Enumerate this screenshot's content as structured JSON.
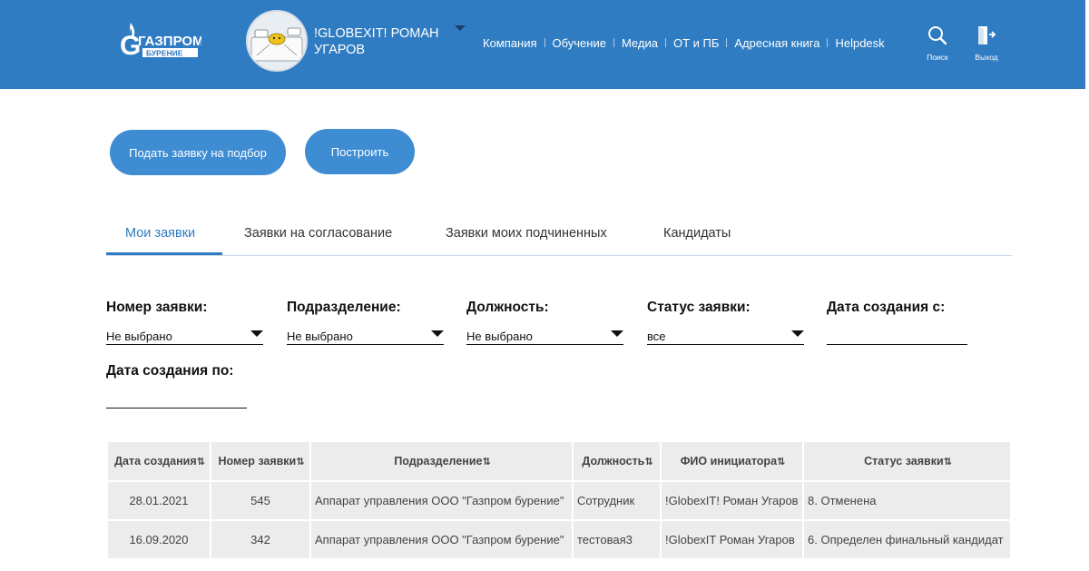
{
  "header": {
    "logo_line1": "ГАЗПРОМ",
    "logo_line2": "БУРЕНИЕ",
    "user_name": "!GLOBEXIT! РОМАН УГАРОВ",
    "nav": [
      "Компания",
      "Обучение",
      "Медиа",
      "ОТ и ПБ",
      "Адресная книга",
      "Helpdesk"
    ],
    "search_label": "Поиск",
    "exit_label": "Выход",
    "brand_color": "#2f7cc2"
  },
  "actions": {
    "request_button": "Подать заявку на подбор",
    "build_button": "Построить"
  },
  "tabs": [
    "Мои заявки",
    "Заявки на согласование",
    "Заявки моих подчиненных",
    "Кандидаты"
  ],
  "active_tab": "Мои заявки",
  "filters": {
    "request_number_label": "Номер заявки:",
    "request_number_value": "Не выбрано",
    "department_label": "Подразделение:",
    "department_value": "Не выбрано",
    "position_label": "Должность:",
    "position_value": "Не выбрано",
    "status_label": "Статус заявки:",
    "status_value": "все",
    "date_from_label": "Дата создания с:",
    "date_from_value": "",
    "date_to_label": "Дата создания по:",
    "date_to_value": ""
  },
  "table": {
    "columns": [
      "Дата создания",
      "Номер заявки",
      "Подразделение",
      "Должность",
      "ФИО инициатора",
      "Статус заявки"
    ],
    "rows": [
      [
        "28.01.2021",
        "545",
        "Аппарат управления ООО \"Газпром бурение\"",
        "Сотрудник",
        "!GlobexIT! Роман Угаров",
        "8. Отменена"
      ],
      [
        "16.09.2020",
        "342",
        "Аппарат управления ООО \"Газпром бурение\"",
        "тестовая3",
        "!GlobexIT Роман Угаров",
        "6. Определен финальный кандидат"
      ]
    ]
  }
}
